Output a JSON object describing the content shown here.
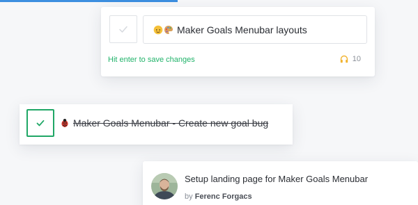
{
  "edit_card": {
    "input_value": "Maker Goals Menubar layouts",
    "input_emojis": [
      "face-emoji-icon",
      "palette-emoji-icon"
    ],
    "hint": "Hit enter to save changes",
    "streak_icon": "headphones-icon",
    "streak_count": "10"
  },
  "done_card": {
    "emoji": "bug-emoji-icon",
    "text": "Maker Goals Menubar - Create new goal bug",
    "checked": true
  },
  "feed_card": {
    "title": "Setup landing page for Maker Goals Menubar",
    "by_prefix": "by",
    "author": "Ferenc Forgacs"
  },
  "colors": {
    "accent_green": "#1fa766",
    "hint_green": "#21b36a",
    "top_accent_blue": "#3d8fe0"
  }
}
